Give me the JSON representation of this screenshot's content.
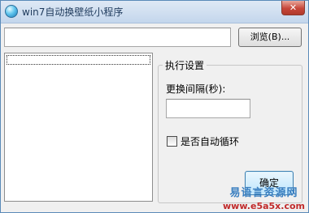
{
  "window": {
    "title": "win7自动换壁纸小程序",
    "close_symbol": "✕"
  },
  "path_field": {
    "value": "",
    "placeholder": ""
  },
  "browse_button": {
    "label": "浏览(B)..."
  },
  "settings": {
    "group_title": "执行设置",
    "interval_label": "更换间隔(秒):",
    "interval_value": "",
    "auto_loop_label": "是否自动循环",
    "auto_loop_checked": false
  },
  "ok_button": {
    "label": "确定"
  },
  "watermark": {
    "text": "易语言资源网",
    "url": "www.e5a5x.com"
  },
  "colors": {
    "title_bar": "#c3d6ec",
    "close_button": "#c7473a",
    "watermark_blue": "#3a7fc0",
    "watermark_red": "#c02a2a"
  }
}
